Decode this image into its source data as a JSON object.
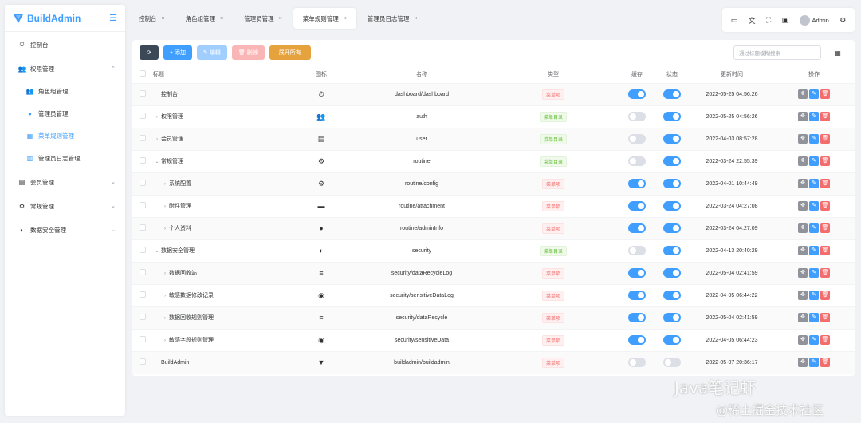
{
  "brand": {
    "name": "BuildAdmin"
  },
  "sidebar": {
    "items": [
      {
        "label": "控制台",
        "icon": "dashboard-icon"
      },
      {
        "label": "权限管理",
        "icon": "users-icon",
        "open": true
      },
      {
        "label": "会员管理",
        "icon": "id-card-icon"
      },
      {
        "label": "常规管理",
        "icon": "cogs-icon"
      },
      {
        "label": "数据安全管理",
        "icon": "shield-icon"
      }
    ],
    "sub_items": [
      {
        "label": "角色组管理",
        "icon": "users-icon"
      },
      {
        "label": "管理员管理",
        "icon": "user-icon"
      },
      {
        "label": "菜单规则管理",
        "icon": "grid-icon",
        "active": true
      },
      {
        "label": "管理员日志管理",
        "icon": "clipboard-icon"
      }
    ]
  },
  "tabs": [
    {
      "label": "控制台"
    },
    {
      "label": "角色组管理"
    },
    {
      "label": "管理员管理"
    },
    {
      "label": "菜单规则管理",
      "active": true
    },
    {
      "label": "管理员日志管理"
    }
  ],
  "header": {
    "user": "Admin"
  },
  "toolbar": {
    "refresh": "⟳",
    "add": "+ 添加",
    "edit": "✎ 编辑",
    "delete": "🗑 删除",
    "expand": "展开所有",
    "search_placeholder": "通过标题模糊搜索"
  },
  "table": {
    "columns": [
      "标题",
      "图标",
      "名称",
      "类型",
      "缓存",
      "状态",
      "更新时间",
      "操作"
    ],
    "rows": [
      {
        "title": "控制台",
        "indent": 0,
        "caret": "",
        "icon": "⏱",
        "name": "dashboard/dashboard",
        "type": "菜单项",
        "type_color": "red",
        "cache": true,
        "status": true,
        "updated": "2022-05-25 04:56:26"
      },
      {
        "title": "权限管理",
        "indent": 0,
        "caret": "›",
        "icon": "👥",
        "name": "auth",
        "type": "菜单目录",
        "type_color": "green",
        "cache": false,
        "status": true,
        "updated": "2022-05-25 04:56:26"
      },
      {
        "title": "会员管理",
        "indent": 0,
        "caret": "›",
        "icon": "▤",
        "name": "user",
        "type": "菜单目录",
        "type_color": "green",
        "cache": false,
        "status": true,
        "updated": "2022-04-03 08:57:28"
      },
      {
        "title": "常规管理",
        "indent": 0,
        "caret": "⌄",
        "icon": "⚙",
        "name": "routine",
        "type": "菜单目录",
        "type_color": "green",
        "cache": false,
        "status": true,
        "updated": "2022-03-24 22:55:39"
      },
      {
        "title": "系统配置",
        "indent": 1,
        "caret": "›",
        "icon": "⚙",
        "name": "routine/config",
        "type": "菜单项",
        "type_color": "red",
        "cache": true,
        "status": true,
        "updated": "2022-04-01 10:44:49"
      },
      {
        "title": "附件管理",
        "indent": 1,
        "caret": "›",
        "icon": "▬",
        "name": "routine/attachment",
        "type": "菜单项",
        "type_color": "red",
        "cache": true,
        "status": true,
        "updated": "2022-03-24 04:27:08"
      },
      {
        "title": "个人资料",
        "indent": 1,
        "caret": "›",
        "icon": "●",
        "name": "routine/adminInfo",
        "type": "菜单项",
        "type_color": "red",
        "cache": true,
        "status": true,
        "updated": "2022-03-24 04:27:09"
      },
      {
        "title": "数据安全管理",
        "indent": 0,
        "caret": "⌄",
        "icon": "◐",
        "name": "security",
        "type": "菜单目录",
        "type_color": "green",
        "cache": false,
        "status": true,
        "updated": "2022-04-13 20:40:29"
      },
      {
        "title": "数据回收站",
        "indent": 1,
        "caret": "›",
        "icon": "≡",
        "name": "security/dataRecycleLog",
        "type": "菜单项",
        "type_color": "red",
        "cache": true,
        "status": true,
        "updated": "2022-05-04 02:41:59"
      },
      {
        "title": "敏感数据修改记录",
        "indent": 1,
        "caret": "›",
        "icon": "◉",
        "name": "security/sensitiveDataLog",
        "type": "菜单项",
        "type_color": "red",
        "cache": true,
        "status": true,
        "updated": "2022-04-05 06:44:22"
      },
      {
        "title": "数据回收规则管理",
        "indent": 1,
        "caret": "›",
        "icon": "≡",
        "name": "security/dataRecycle",
        "type": "菜单项",
        "type_color": "red",
        "cache": true,
        "status": true,
        "updated": "2022-05-04 02:41:59"
      },
      {
        "title": "敏感字段规则管理",
        "indent": 1,
        "caret": "›",
        "icon": "◉",
        "name": "security/sensitiveData",
        "type": "菜单项",
        "type_color": "red",
        "cache": true,
        "status": true,
        "updated": "2022-04-05 06:44:23"
      },
      {
        "title": "BuildAdmin",
        "indent": 0,
        "caret": "",
        "icon": "▼",
        "name": "buildadmin/buildadmin",
        "type": "菜单项",
        "type_color": "red",
        "cache": false,
        "status": false,
        "updated": "2022-05-07 20:36:17"
      }
    ]
  },
  "watermark": {
    "line1": "Java笔记虾",
    "line2": "@稀土掘金技术社区"
  }
}
